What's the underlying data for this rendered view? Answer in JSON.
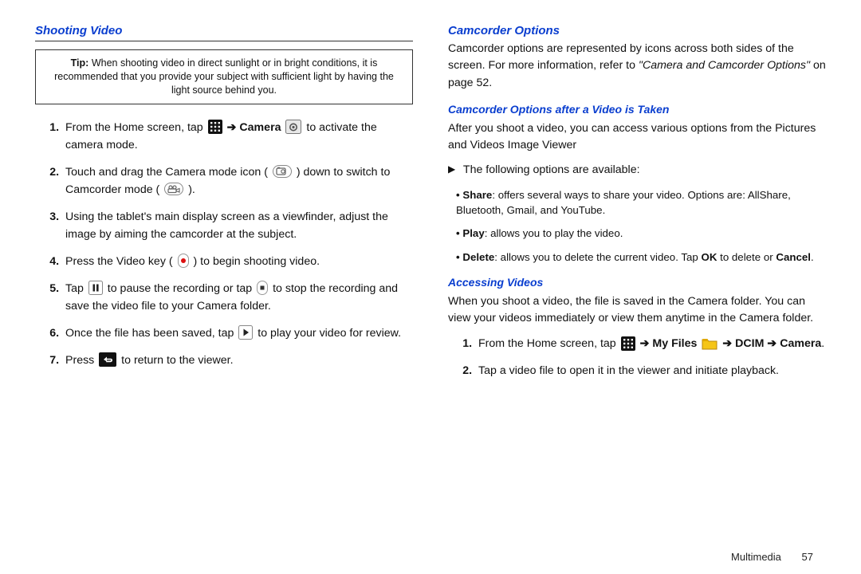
{
  "left": {
    "heading": "Shooting Video",
    "tip_label": "Tip:",
    "tip_body": "When shooting video in direct sunlight or in bright conditions, it is recommended that you provide your subject with sufficient light by having the light source behind you.",
    "steps": {
      "s1a": "From the Home screen, tap ",
      "s1b": " ➔ ",
      "s1c": "Camera",
      "s1d": " to activate the camera mode.",
      "s2a": "Touch and drag the Camera mode icon (",
      "s2b": ") down to switch to Camcorder mode (",
      "s2c": ").",
      "s3": "Using the tablet's main display screen as a viewfinder, adjust the image by aiming the camcorder at the subject.",
      "s4a": "Press the Video key (",
      "s4b": ") to begin shooting video.",
      "s5a": "Tap ",
      "s5b": " to pause the recording or tap ",
      "s5c": " to stop the recording and save the video file to your Camera folder.",
      "s6a": "Once the file has been saved, tap ",
      "s6b": " to play your video for review.",
      "s7a": "Press ",
      "s7b": " to return to the viewer."
    }
  },
  "right": {
    "h1": "Camcorder Options",
    "p1a": "Camcorder options are represented by icons across both sides of the screen. For more information, refer to ",
    "p1b": "\"Camera and Camcorder Options\"",
    "p1c": " on page 52.",
    "h2": "Camcorder Options after a Video is Taken",
    "p2": "After you shoot a video, you can access various options from the Pictures and Videos Image Viewer",
    "tri_line": "The following options are available:",
    "opts": {
      "share_l": "Share",
      "share_t": ": offers several ways to share your video. Options are: AllShare, Bluetooth, Gmail, and YouTube.",
      "play_l": "Play",
      "play_t": ": allows you to play the video.",
      "del_l": "Delete",
      "del_t1": ": allows you to delete the current video. Tap ",
      "del_ok": "OK",
      "del_t2": " to delete or ",
      "del_cancel": "Cancel",
      "del_t3": "."
    },
    "h3": "Accessing Videos",
    "p3": "When you shoot a video, the file is saved in the Camera folder. You can view your videos immediately or view them anytime in the Camera folder.",
    "steps": {
      "s1a": "From the Home screen, tap ",
      "s1b": " ➔ ",
      "s1c": "My Files",
      "s1d": "  ➔ ",
      "s1e": "DCIM",
      "s1f": " ➔ ",
      "s1g": "Camera",
      "s1h": ".",
      "s2": "Tap a video file to open it in the viewer and initiate playback."
    }
  },
  "footer": {
    "section": "Multimedia",
    "page": "57"
  }
}
